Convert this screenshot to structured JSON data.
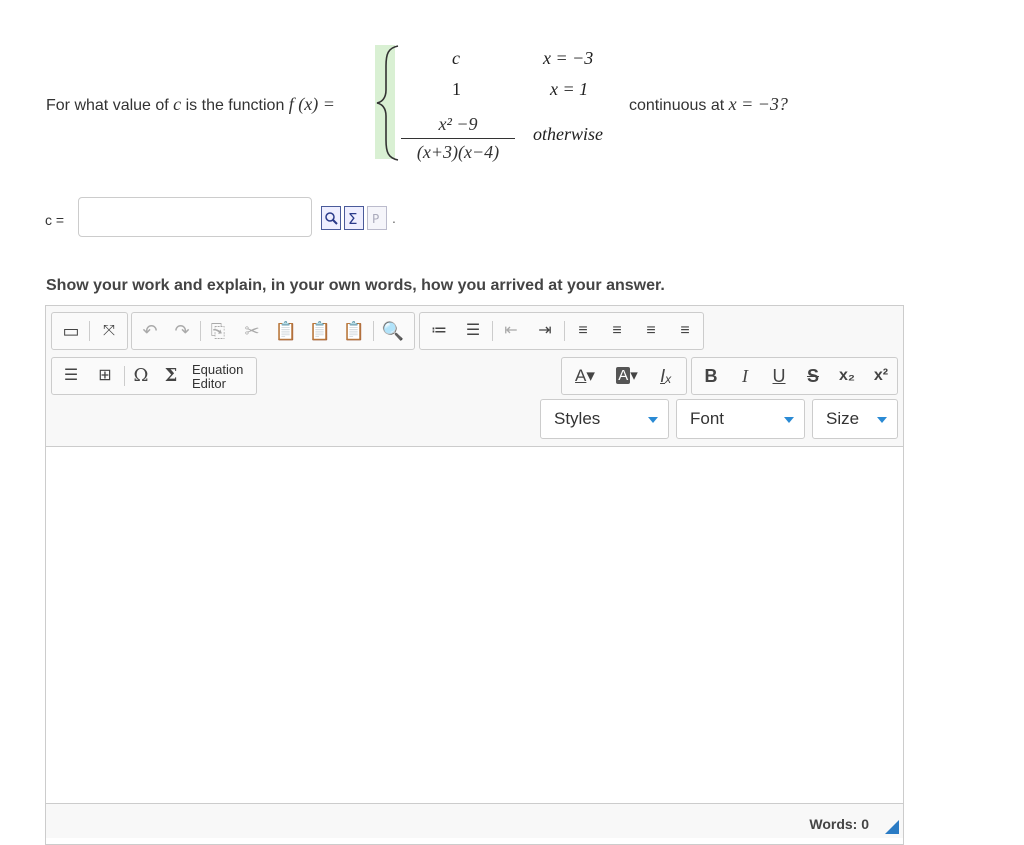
{
  "question": {
    "prefix_text": "For what value of ",
    "prefix_var": "c",
    "prefix_text2": " is the function ",
    "function_lhs": "f (x) =",
    "cases": [
      {
        "value": "c",
        "condition": "x = −3"
      },
      {
        "value": "1",
        "condition": "x = 1"
      },
      {
        "value_num": "x² −9",
        "value_den": "(x+3)(x−4)",
        "condition": "otherwise"
      }
    ],
    "suffix_text": "continuous at ",
    "suffix_math": "x = −3?"
  },
  "answer": {
    "label": "c =",
    "value": "",
    "trailing": "."
  },
  "work_prompt": "Show your work and explain, in your own words, how you arrived at your answer.",
  "editor": {
    "equation_editor_label_1": "Equation",
    "equation_editor_label_2": "Editor",
    "styles_label": "Styles",
    "font_label": "Font",
    "size_label": "Size",
    "word_count": "Words: 0",
    "content": ""
  },
  "colors": {
    "highlight": "#d9f0d3",
    "accent": "#2a7bc4"
  }
}
